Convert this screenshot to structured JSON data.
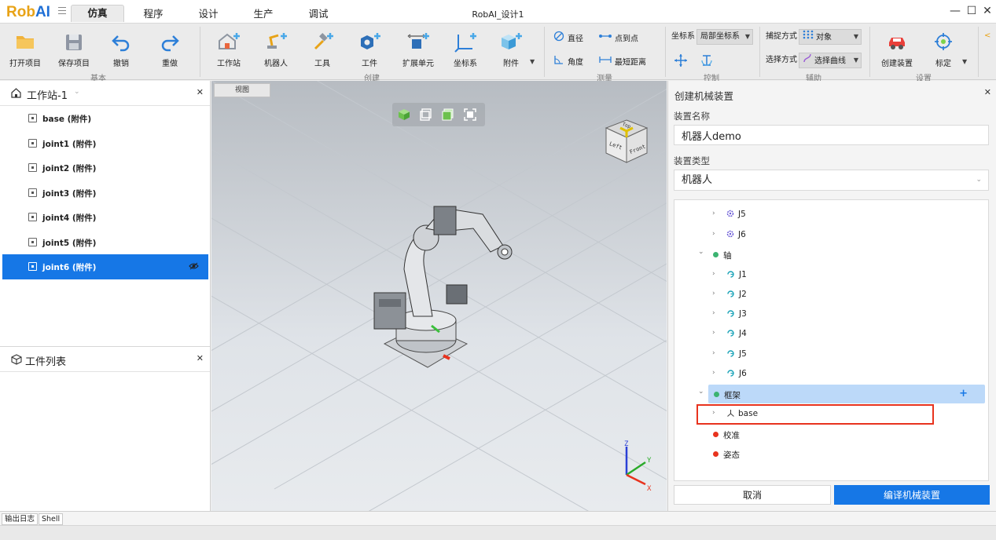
{
  "app": {
    "logo_rob": "Rob",
    "logo_ai": "AI",
    "window_title": "RobAI_设计1"
  },
  "menu_tabs": [
    {
      "label": "仿真",
      "active": true
    },
    {
      "label": "程序",
      "active": false
    },
    {
      "label": "设计",
      "active": false
    },
    {
      "label": "生产",
      "active": false
    },
    {
      "label": "调试",
      "active": false
    }
  ],
  "window_controls": {
    "minimize": "—",
    "maximize": "☐",
    "close": "✕"
  },
  "ribbon": {
    "basic": {
      "open": "打开项目",
      "save": "保存项目",
      "undo": "撤销",
      "redo": "重做",
      "group": "基本"
    },
    "create": {
      "workstation": "工作站",
      "robot": "机器人",
      "tool": "工具",
      "part": "工件",
      "ext_unit": "扩展单元",
      "coord": "坐标系",
      "attachment": "附件",
      "group": "创建"
    },
    "measure": {
      "diameter": "直径",
      "point_to_point": "点到点",
      "angle": "角度",
      "shortest": "最短距离",
      "group": "测量"
    },
    "control": {
      "coord_label": "坐标系",
      "coord_value": "局部坐标系",
      "group": "控制"
    },
    "assist": {
      "snap_label": "捕捉方式",
      "snap_value": "对象",
      "select_label": "选择方式",
      "select_value": "选择曲线",
      "group": "辅助"
    },
    "settings": {
      "create_device": "创建装置",
      "calibrate": "标定",
      "group": "设置"
    }
  },
  "colors": {
    "accent": "#1677e6",
    "highlight": "#bcd9f9",
    "warning_box": "#e8331e",
    "green_dot": "#3cb371",
    "red_dot": "#e8331e"
  },
  "workstation_panel": {
    "title": "工作站-1",
    "items": [
      {
        "label": "base (附件)",
        "selected": false
      },
      {
        "label": "joint1 (附件)",
        "selected": false
      },
      {
        "label": "joint2 (附件)",
        "selected": false
      },
      {
        "label": "joint3 (附件)",
        "selected": false
      },
      {
        "label": "joint4 (附件)",
        "selected": false
      },
      {
        "label": "joint5 (附件)",
        "selected": false
      },
      {
        "label": "joint6 (附件)",
        "selected": true
      }
    ]
  },
  "part_list_panel": {
    "title": "工件列表"
  },
  "viewport": {
    "tab": "视图",
    "cube_top": "Top",
    "cube_left": "Left",
    "cube_front": "Front",
    "axis_z": "Z",
    "axis_y": "Y",
    "axis_x": "X"
  },
  "device_panel": {
    "title": "创建机械装置",
    "name_label": "装置名称",
    "name_value": "机器人demo",
    "type_label": "装置类型",
    "type_value": "机器人",
    "tree": [
      {
        "label": "J5",
        "kind": "joint"
      },
      {
        "label": "J6",
        "kind": "joint"
      },
      {
        "label": "轴",
        "kind": "group-green"
      },
      {
        "label": "J1",
        "kind": "axis"
      },
      {
        "label": "J2",
        "kind": "axis"
      },
      {
        "label": "J3",
        "kind": "axis"
      },
      {
        "label": "J4",
        "kind": "axis"
      },
      {
        "label": "J5",
        "kind": "axis"
      },
      {
        "label": "J6",
        "kind": "axis"
      },
      {
        "label": "框架",
        "kind": "group-green-hl"
      },
      {
        "label": "base",
        "kind": "frame"
      },
      {
        "label": "校准",
        "kind": "group-red"
      },
      {
        "label": "姿态",
        "kind": "group-red"
      }
    ],
    "add_symbol": "+",
    "cancel": "取消",
    "compile": "编译机械装置"
  },
  "bottom_tabs": [
    "输出日志",
    "Shell"
  ]
}
